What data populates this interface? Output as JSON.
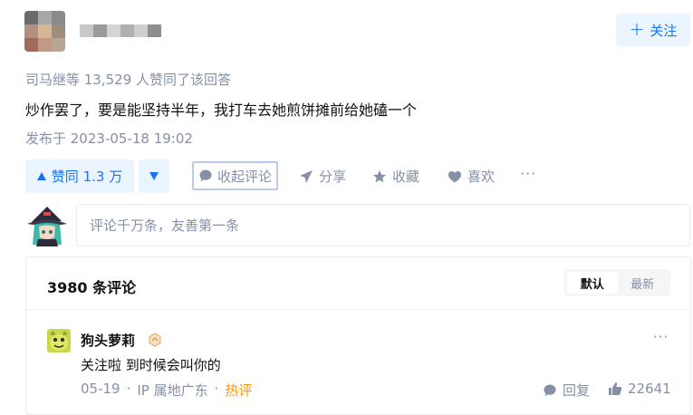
{
  "header": {
    "follow_label": "关注",
    "follow_icon": "plus-icon"
  },
  "answer": {
    "meta": "司马继等 13,529 人赞同了该回答",
    "content": "炒作罢了，要是能坚持半年，我打车去她煎饼摊前给她磕一个",
    "published": "发布于 2023-05-18 19:02"
  },
  "actions": {
    "vote_label": "赞同 1.3 万",
    "collapse_label": "收起评论",
    "share_label": "分享",
    "favorite_label": "收藏",
    "like_label": "喜欢",
    "more": "···"
  },
  "comment_input": {
    "placeholder": "评论千万条，友善第一条"
  },
  "comments": {
    "title": "3980 条评论",
    "sort_options": [
      "默认",
      "最新"
    ],
    "sort_selected": "默认",
    "items": [
      {
        "author": "狗头萝莉",
        "text": "关注啦 到时候会叫你的",
        "date": "05-19",
        "location": "IP 属地广东",
        "tag": "热评",
        "reply_label": "回复",
        "likes": "22641",
        "more": "···"
      }
    ]
  },
  "colors": {
    "accent": "#1772f6",
    "accent_bg": "#ebf5ff",
    "muted": "#8590a6",
    "hot": "#ff9607"
  }
}
